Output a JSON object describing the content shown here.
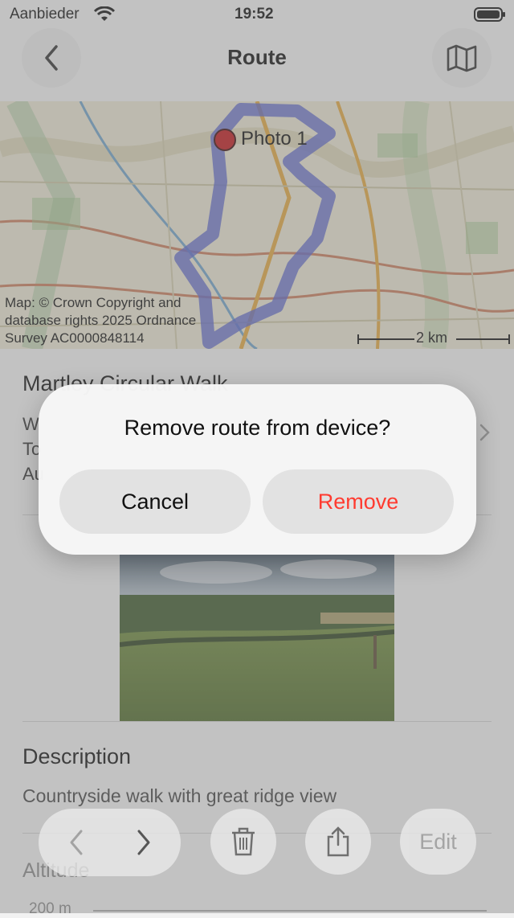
{
  "status_bar": {
    "carrier": "Aanbieder",
    "time": "19:52"
  },
  "nav": {
    "title": "Route",
    "back_icon": "chevron-left-icon",
    "map_icon": "map-icon"
  },
  "map": {
    "marker_label": "Photo 1",
    "attribution": [
      "Map: © Crown Copyright and",
      "database rights 2025 Ordnance",
      "Survey AC0000848114"
    ],
    "scale_label": "2 km",
    "route_color": "#5560c8",
    "marker_color": "#c0181a"
  },
  "route": {
    "name": "Martley Circular Walk",
    "meta_lines": [
      "W",
      "To",
      "Au"
    ]
  },
  "description": {
    "heading": "Description",
    "text": "Countryside walk with great ridge view"
  },
  "altitude": {
    "heading": "Altitude",
    "tick": "200 m"
  },
  "toolbar": {
    "prev_icon": "chevron-left-icon",
    "next_icon": "chevron-right-icon",
    "delete_icon": "trash-icon",
    "share_icon": "share-icon",
    "edit_label": "Edit"
  },
  "dialog": {
    "title": "Remove route from device?",
    "cancel_label": "Cancel",
    "remove_label": "Remove",
    "remove_color": "#ff3b30"
  }
}
